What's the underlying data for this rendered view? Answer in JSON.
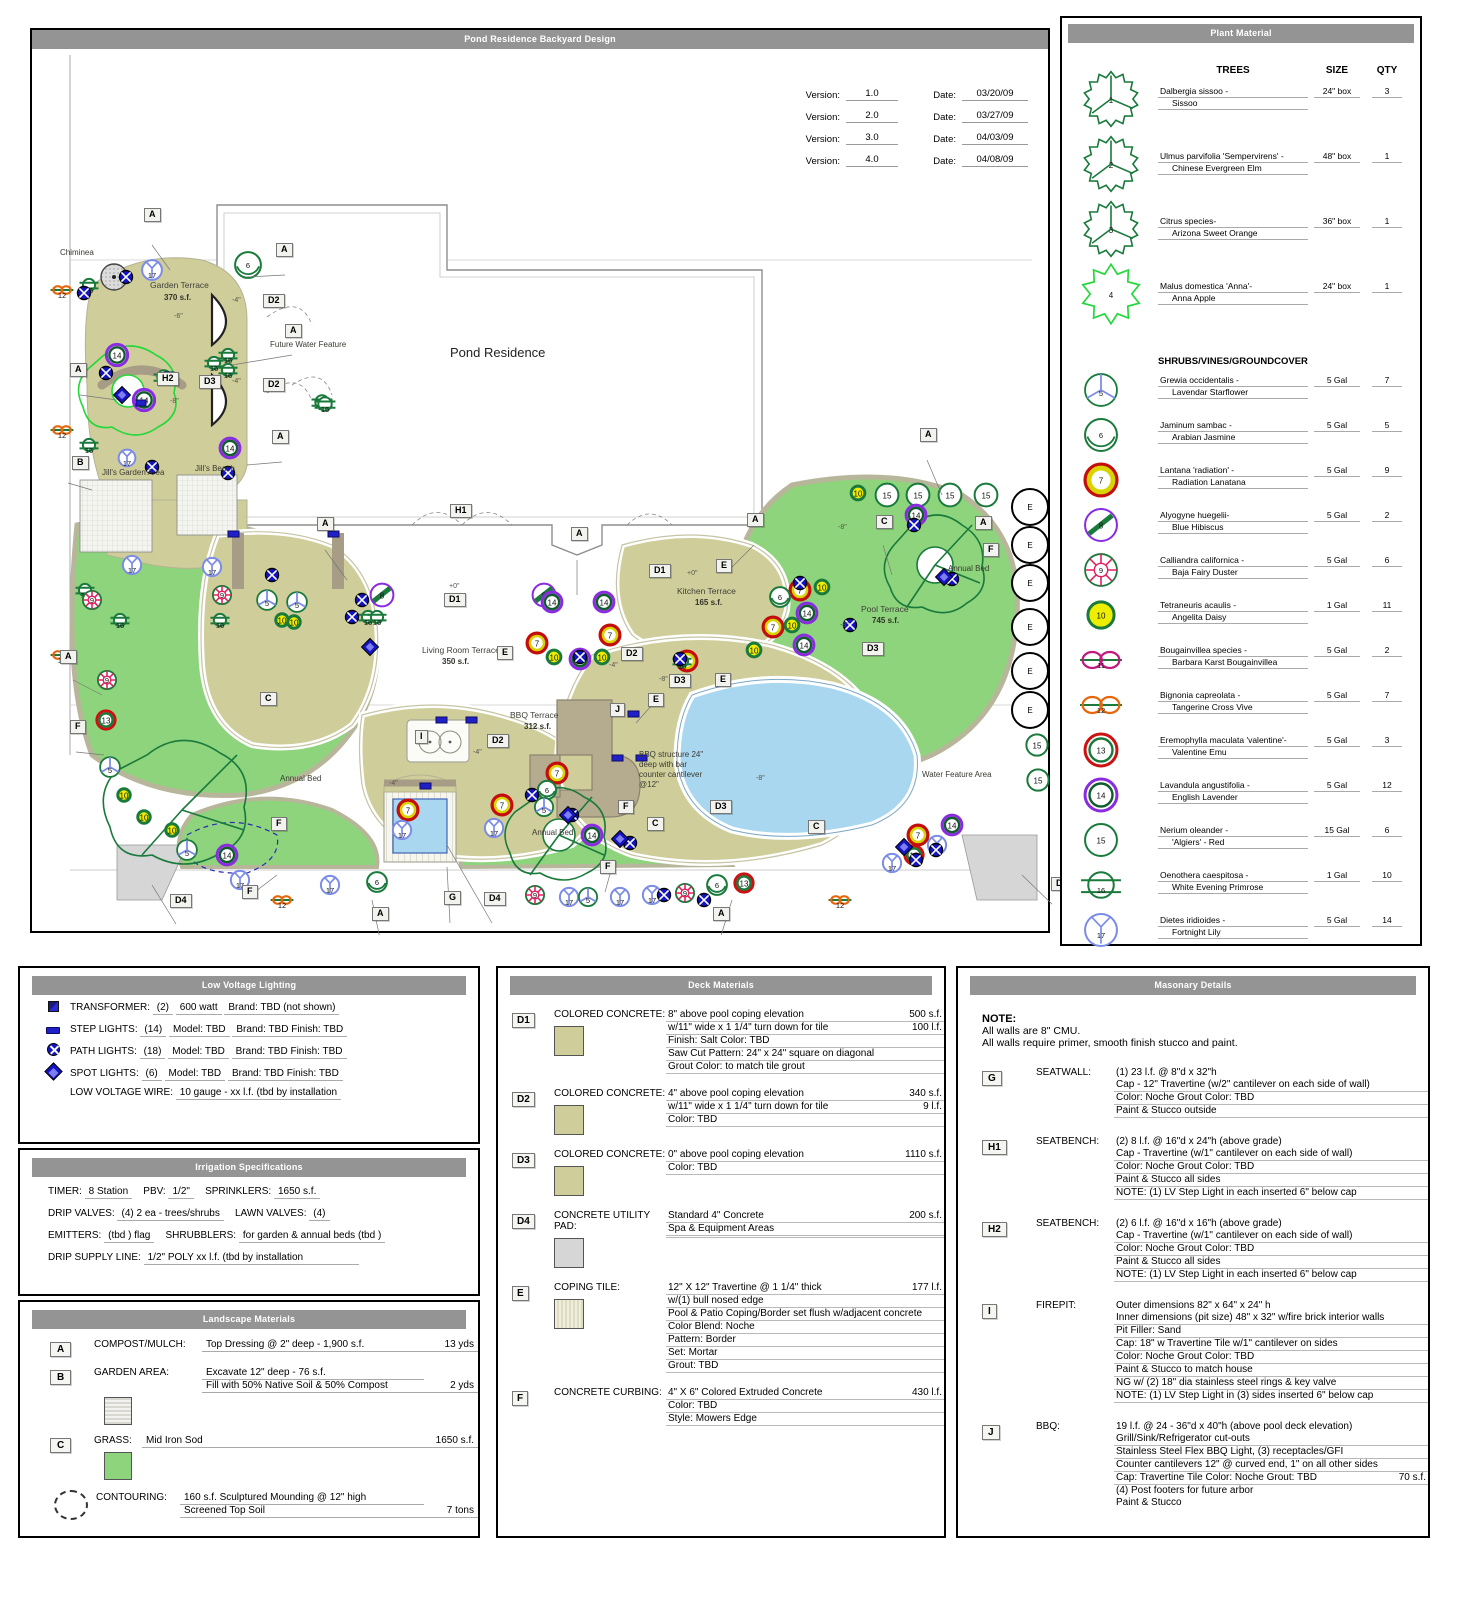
{
  "plan": {
    "title": "Pond Residence Backyard Design",
    "house_label": "Pond Residence",
    "versions": [
      {
        "vlabel": "Version:",
        "version": "1.0",
        "dlabel": "Date:",
        "date": "03/20/09"
      },
      {
        "vlabel": "Version:",
        "version": "2.0",
        "dlabel": "Date:",
        "date": "03/27/09"
      },
      {
        "vlabel": "Version:",
        "version": "3.0",
        "dlabel": "Date:",
        "date": "04/03/09"
      },
      {
        "vlabel": "Version:",
        "version": "4.0",
        "dlabel": "Date:",
        "date": "04/08/09"
      }
    ],
    "areas": [
      {
        "name": "Garden Terrace",
        "sqft": "370 s.f."
      },
      {
        "name": "Living Room Terrace",
        "sqft": "350 s.f."
      },
      {
        "name": "Kitchen Terrace",
        "sqft": "165 s.f."
      },
      {
        "name": "BBQ Terrace",
        "sqft": "312 s.f."
      },
      {
        "name": "Pool Terrace",
        "sqft": "745 s.f."
      }
    ],
    "notes": {
      "chiminea": "Chiminea",
      "future_water": "Future Water Feature",
      "jills_garden": "Jill's Garden Area",
      "jills_beach": "Jill's Beach",
      "annual_bed": "Annual Bed",
      "water_feature_area": "Water Feature Area",
      "bbq_structure": "BBQ structure 24\" deep with bar counter cantilever @12\""
    },
    "elevations": [
      "+0\"",
      "-4\"",
      "-6\"",
      "-8\""
    ]
  },
  "plant_material": {
    "title": "Plant Material",
    "columns": {
      "trees": "TREES",
      "size": "SIZE",
      "qty": "QTY"
    },
    "section_shrubs": "SHRUBS/VINES/GROUNDCOVER",
    "trees": [
      {
        "key": "1",
        "botanical": "Dalbergia sissoo -",
        "common": "Sissoo",
        "size": "24\" box",
        "qty": "3"
      },
      {
        "key": "2",
        "botanical": "Ulmus parvifolia 'Sempervirens' -",
        "common": "Chinese Evergreen Elm",
        "size": "48\" box",
        "qty": "1"
      },
      {
        "key": "3",
        "botanical": "Citrus species-",
        "common": "Arizona Sweet Orange",
        "size": "36\" box",
        "qty": "1"
      },
      {
        "key": "4",
        "botanical": "Malus domestica 'Anna'-",
        "common": "Anna Apple",
        "size": "24\" box",
        "qty": "1"
      }
    ],
    "shrubs": [
      {
        "key": "5",
        "botanical": "Grewia occidentalis -",
        "common": "Lavendar Starflower",
        "size": "5 Gal",
        "qty": "7"
      },
      {
        "key": "6",
        "botanical": "Jaminum sambac -",
        "common": "Arabian Jasmine",
        "size": "5 Gal",
        "qty": "5"
      },
      {
        "key": "7",
        "botanical": "Lantana 'radiation' -",
        "common": "Radiation Lanatana",
        "size": "5 Gal",
        "qty": "9"
      },
      {
        "key": "8",
        "botanical": "Alyogyne huegelii-",
        "common": "Blue Hibiscus",
        "size": "5 Gal",
        "qty": "2"
      },
      {
        "key": "9",
        "botanical": "Calliandra californica -",
        "common": "Baja Fairy Duster",
        "size": "5 Gal",
        "qty": "6"
      },
      {
        "key": "10",
        "botanical": "Tetraneuris acaulis -",
        "common": "Angelita Daisy",
        "size": "1 Gal",
        "qty": "11"
      },
      {
        "key": "11",
        "botanical": "Bougainvillea species -",
        "common": "Barbara Karst Bougainvillea",
        "size": "5 Gal",
        "qty": "2"
      },
      {
        "key": "12",
        "botanical": "Bignonia capreolata -",
        "common": "Tangerine Cross Vive",
        "size": "5 Gal",
        "qty": "7"
      },
      {
        "key": "13",
        "botanical": "Eremophylla maculata 'valentine'-",
        "common": "Valentine Emu",
        "size": "5 Gal",
        "qty": "3"
      },
      {
        "key": "14",
        "botanical": "Lavandula angustifolia -",
        "common": "English Lavender",
        "size": "5 Gal",
        "qty": "12"
      },
      {
        "key": "15",
        "botanical": "Nerium oleander -",
        "common": "'Algiers' - Red",
        "size": "15 Gal",
        "qty": "6"
      },
      {
        "key": "16",
        "botanical": "Oenothera caespitosa -",
        "common": "White Evening Primrose",
        "size": "1 Gal",
        "qty": "10"
      },
      {
        "key": "17",
        "botanical": "Dietes iridioides -",
        "common": "Fortnight Lily",
        "size": "5 Gal",
        "qty": "14"
      }
    ]
  },
  "low_voltage": {
    "title": "Low Voltage Lighting",
    "rows": [
      {
        "icon": "transformer-icon",
        "label": "TRANSFORMER:",
        "qty": "(2)",
        "spec": "600 watt",
        "extra": "Brand: TBD   (not shown)"
      },
      {
        "icon": "step-light-icon",
        "label": "STEP LIGHTS:",
        "qty": "(14)",
        "spec": "Model: TBD",
        "extra": "Brand: TBD  Finish:  TBD"
      },
      {
        "icon": "path-light-icon",
        "label": "PATH LIGHTS:",
        "qty": "(18)",
        "spec": "Model: TBD",
        "extra": "Brand: TBD  Finish:  TBD"
      },
      {
        "icon": "spot-light-icon",
        "label": "SPOT LIGHTS:",
        "qty": "(6)",
        "spec": "Model: TBD",
        "extra": "Brand: TBD  Finish:  TBD"
      }
    ],
    "wire_label": "LOW VOLTAGE WIRE:",
    "wire_value": "10 gauge - xx l.f. (tbd by installation"
  },
  "irrigation": {
    "title": "Irrigation Specifications",
    "lines": [
      {
        "a_label": "TIMER:",
        "a_value": "8 Station",
        "b_label": "PBV:",
        "b_value": "1/2\"",
        "c_label": "SPRINKLERS:",
        "c_value": "1650 s.f."
      },
      {
        "a_label": "DRIP VALVES:",
        "a_value": "(4) 2 ea - trees/shrubs",
        "c_label": "LAWN VALVES:",
        "c_value": "(4)"
      },
      {
        "a_label": "EMITTERS:",
        "a_value": "(tbd ) flag",
        "c_label": "SHRUBBLERS:",
        "c_value": "for garden & annual beds (tbd )"
      },
      {
        "a_label": "DRIP SUPPLY LINE:",
        "a_value": "1/2\" POLY   xx l.f. (tbd by installation"
      }
    ]
  },
  "landscape_materials": {
    "title": "Landscape Materials",
    "rows": [
      {
        "tag": "A",
        "label": "COMPOST/MULCH:",
        "value": "Top Dressing  @  2\" deep - 1,900  s.f.",
        "qty": "13 yds",
        "swatch": "none"
      },
      {
        "tag": "B",
        "label": "GARDEN AREA:",
        "value": "Excavate 12\"  deep  -  76 s.f.",
        "value2": "Fill with 50% Native Soil & 50% Compost",
        "qty2": "2 yds",
        "swatch": "grid"
      },
      {
        "tag": "C",
        "label": "GRASS:",
        "value": "Mid Iron Sod",
        "qty": "1650  s.f.",
        "swatch": "grass"
      },
      {
        "tag": "",
        "label": "CONTOURING:",
        "value": "160 s.f. Sculptured Mounding @ 12\" high",
        "value2": "Screened Top Soil",
        "qty2": "7 tons",
        "swatch": "dashed"
      }
    ]
  },
  "deck_materials": {
    "title": "Deck Materials",
    "rows": [
      {
        "tag": "D1",
        "caption": "COLORED CONCRETE:",
        "swatch": "tan",
        "lines": [
          {
            "text": "8\" above pool coping elevation",
            "qty": "500 s.f."
          },
          {
            "text": " w/11\" wide x 1 1/4\" turn down for tile",
            "qty": "100 l.f."
          },
          {
            "text": "Finish:  Salt            Color: TBD",
            "qty": ""
          },
          {
            "text": "Saw Cut Pattern: 24\" x 24\" square on diagonal",
            "qty": ""
          },
          {
            "text": "Grout Color: to match tile grout",
            "qty": ""
          }
        ]
      },
      {
        "tag": "D2",
        "caption": "COLORED CONCRETE:",
        "swatch": "tan",
        "lines": [
          {
            "text": "4\" above pool coping elevation",
            "qty": "340 s.f."
          },
          {
            "text": "w/11\" wide x 1 1/4\" turn down for tile",
            "qty": "9 l.f."
          },
          {
            "text": "Color: TBD",
            "qty": ""
          }
        ]
      },
      {
        "tag": "D3",
        "caption": "COLORED CONCRETE:",
        "swatch": "tan",
        "lines": [
          {
            "text": "0\" above pool coping elevation",
            "qty": "1110  s.f."
          },
          {
            "text": "Color: TBD",
            "qty": ""
          }
        ]
      },
      {
        "tag": "D4",
        "caption": "CONCRETE UTILITY PAD:",
        "swatch": "gray",
        "lines": [
          {
            "text": "Standard 4\" Concrete",
            "qty": "200  s.f."
          },
          {
            "text": "Spa & Equipment Areas",
            "qty": ""
          },
          {
            "text": "",
            "qty": ""
          }
        ]
      },
      {
        "tag": "E",
        "caption": "COPING TILE:",
        "swatch": "trav",
        "lines": [
          {
            "text": "12\" X 12\" Travertine @ 1 1/4\" thick",
            "qty": "177 l.f."
          },
          {
            "text": "w/(1) bull nosed edge",
            "qty": ""
          },
          {
            "text": "Pool & Patio Coping/Border set flush w/adjacent concrete",
            "qty": ""
          },
          {
            "text": "Color Blend: Noche",
            "qty": ""
          },
          {
            "text": "Pattern: Border",
            "qty": ""
          },
          {
            "text": "Set: Mortar",
            "qty": ""
          },
          {
            "text": "Grout: TBD",
            "qty": ""
          }
        ]
      },
      {
        "tag": "F",
        "caption": "CONCRETE CURBING:",
        "swatch": "none",
        "lines": [
          {
            "text": "4\" X 6\" Colored Extruded Concrete",
            "qty": "430 l.f."
          },
          {
            "text": "Color: TBD",
            "qty": ""
          },
          {
            "text": "Style:  Mowers Edge",
            "qty": ""
          }
        ]
      }
    ]
  },
  "masonry": {
    "title": "Masonary Details",
    "note_head": "NOTE:",
    "note_lines": [
      "All walls are 8\" CMU.",
      "All walls require primer, smooth finish stucco and paint."
    ],
    "rows": [
      {
        "tag": "G",
        "caption": "SEATWALL:",
        "lines": [
          {
            "text": "(1) 23 l.f. @ 8\"d x 32\"h",
            "qty": "",
            "nb": true
          },
          {
            "text": "Cap - 12\" Travertine (w/2\" cantilever on each side of wall)",
            "qty": ""
          },
          {
            "text": "Color: Noche                   Grout Color:  TBD",
            "qty": ""
          },
          {
            "text": "Paint & Stucco outside",
            "qty": ""
          }
        ]
      },
      {
        "tag": "H1",
        "caption": "SEATBENCH:",
        "lines": [
          {
            "text": "(2) 8 l.f. @ 16\"d x 24\"h (above grade)",
            "qty": "",
            "nb": true
          },
          {
            "text": "Cap -  Travertine (w/1\" cantilever on each side of wall)",
            "qty": ""
          },
          {
            "text": "Color: Noche                   Grout Color:  TBD",
            "qty": ""
          },
          {
            "text": "Paint & Stucco all sides",
            "qty": ""
          },
          {
            "text": "NOTE: (1) LV Step Light in each inserted 6\" below cap",
            "qty": ""
          }
        ]
      },
      {
        "tag": "H2",
        "caption": "SEATBENCH:",
        "lines": [
          {
            "text": "(2) 6 l.f. @ 16\"d x 16\"h (above grade)",
            "qty": "",
            "nb": true
          },
          {
            "text": "Cap -  Travertine (w/1\" cantilever on each side of wall)",
            "qty": ""
          },
          {
            "text": "Color: Noche                   Grout Color:  TBD",
            "qty": ""
          },
          {
            "text": "Paint & Stucco all sides",
            "qty": ""
          },
          {
            "text": "NOTE: (1) LV Step Light in each inserted 6\" below cap",
            "qty": ""
          }
        ]
      },
      {
        "tag": "I",
        "caption": "FIREPIT:",
        "lines": [
          {
            "text": "Outer dimensions 82\" x 64\" x 24\" h",
            "qty": "",
            "nb": true
          },
          {
            "text": "Inner dimensions (pit size) 48\" x 32\" w/fire brick interior walls",
            "qty": ""
          },
          {
            "text": "Pit Filler:  Sand",
            "qty": ""
          },
          {
            "text": "Cap: 18\" w Travertine Tile w/1\" cantilever on sides",
            "qty": ""
          },
          {
            "text": "Color: Noche                   Grout Color:  TBD",
            "qty": ""
          },
          {
            "text": "Paint & Stucco to match house",
            "qty": ""
          },
          {
            "text": "NG w/ (2) 18\" dia stainless steel rings & key valve",
            "qty": ""
          },
          {
            "text": "NOTE: (1) LV Step Light in (3) sides inserted 6\" below cap",
            "qty": ""
          }
        ]
      },
      {
        "tag": "J",
        "caption": "BBQ:",
        "lines": [
          {
            "text": "19 l.f. @ 24 - 36\"d x 40\"h (above pool deck elevation)",
            "qty": "",
            "nb": true
          },
          {
            "text": "Grill/Sink/Refrigerator cut-outs",
            "qty": ""
          },
          {
            "text": "Stainless Steel Flex BBQ Light, (3) receptacles/GFI",
            "qty": ""
          },
          {
            "text": "Counter cantilevers 12\" @ curved end, 1\" on all other sides",
            "qty": ""
          },
          {
            "text": "Cap: Travertine Tile   Color:  Noche   Grout: TBD",
            "qty": "70 s.f."
          },
          {
            "text": "(4) Post footers for future arbor",
            "qty": "",
            "nb": true
          },
          {
            "text": "Paint & Stucco",
            "qty": "",
            "nb": true
          }
        ]
      }
    ]
  },
  "colors": {
    "header_gray": "#949494",
    "deck_tan": "#cfcd9a",
    "grass_green": "#8ed47c",
    "pool_blue": "#a9d7ef",
    "tree_green": "#1a7a3c",
    "hardscape": "#c9c7a7"
  }
}
